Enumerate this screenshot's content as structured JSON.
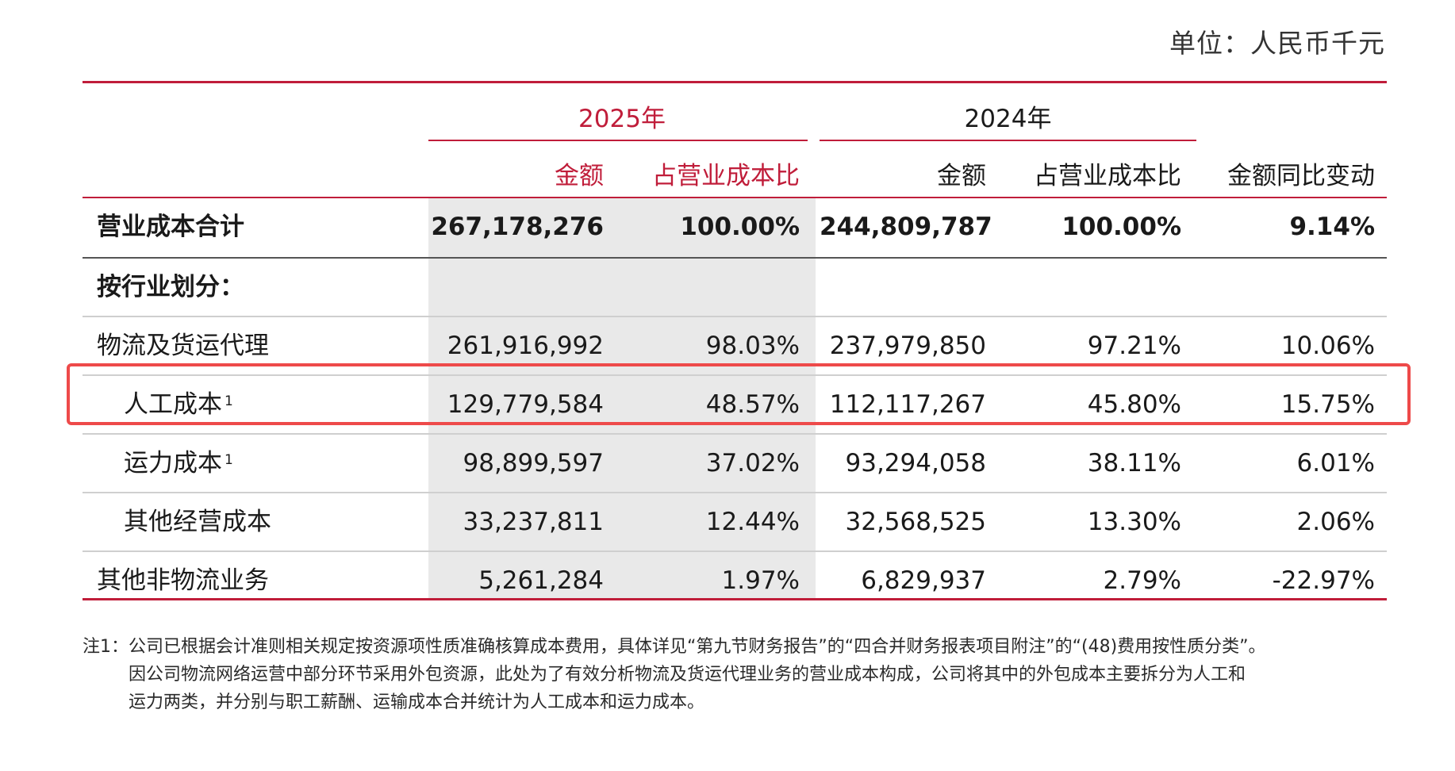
{
  "unit": "单位：人民币千元",
  "header": {
    "year_2025": "2025年",
    "year_2024": "2024年",
    "amount": "金额",
    "ratio": "占营业成本比",
    "yoy": "金额同比变动"
  },
  "rows": [
    {
      "label": "营业成本合计",
      "sup": "",
      "v2025": "267,178,276",
      "r2025": "100.00%",
      "v2024": "244,809,787",
      "r2024": "100.00%",
      "yoy": "9.14%"
    },
    {
      "label": "按行业划分：",
      "sup": "",
      "v2025": "",
      "r2025": "",
      "v2024": "",
      "r2024": "",
      "yoy": ""
    },
    {
      "label": "物流及货运代理",
      "sup": "",
      "v2025": "261,916,992",
      "r2025": "98.03%",
      "v2024": "237,979,850",
      "r2024": "97.21%",
      "yoy": "10.06%"
    },
    {
      "label": "人工成本",
      "sup": "1",
      "v2025": "129,779,584",
      "r2025": "48.57%",
      "v2024": "112,117,267",
      "r2024": "45.80%",
      "yoy": "15.75%"
    },
    {
      "label": "运力成本",
      "sup": "1",
      "v2025": "98,899,597",
      "r2025": "37.02%",
      "v2024": "93,294,058",
      "r2024": "38.11%",
      "yoy": "6.01%"
    },
    {
      "label": "其他经营成本",
      "sup": "",
      "v2025": "33,237,811",
      "r2025": "12.44%",
      "v2024": "32,568,525",
      "r2024": "13.30%",
      "yoy": "2.06%"
    },
    {
      "label": "其他非物流业务",
      "sup": "",
      "v2025": "5,261,284",
      "r2025": "1.97%",
      "v2024": "6,829,937",
      "r2024": "2.79%",
      "yoy": "-22.97%"
    }
  ],
  "notes": {
    "line1": "注1：公司已根据会计准则相关规定按资源项性质准确核算成本费用，具体详见“第九节财务报告”的“四合并财务报表项目附注”的“(48)费用按性质分类”。",
    "line2": "因公司物流网络运营中部分环节采用外包资源，此处为了有效分析物流及货运代理业务的营业成本构成，公司将其中的外包成本主要拆分为人工和",
    "line3": "运力两类，并分别与职工薪酬、运输成本合并统计为人工成本和运力成本。"
  }
}
